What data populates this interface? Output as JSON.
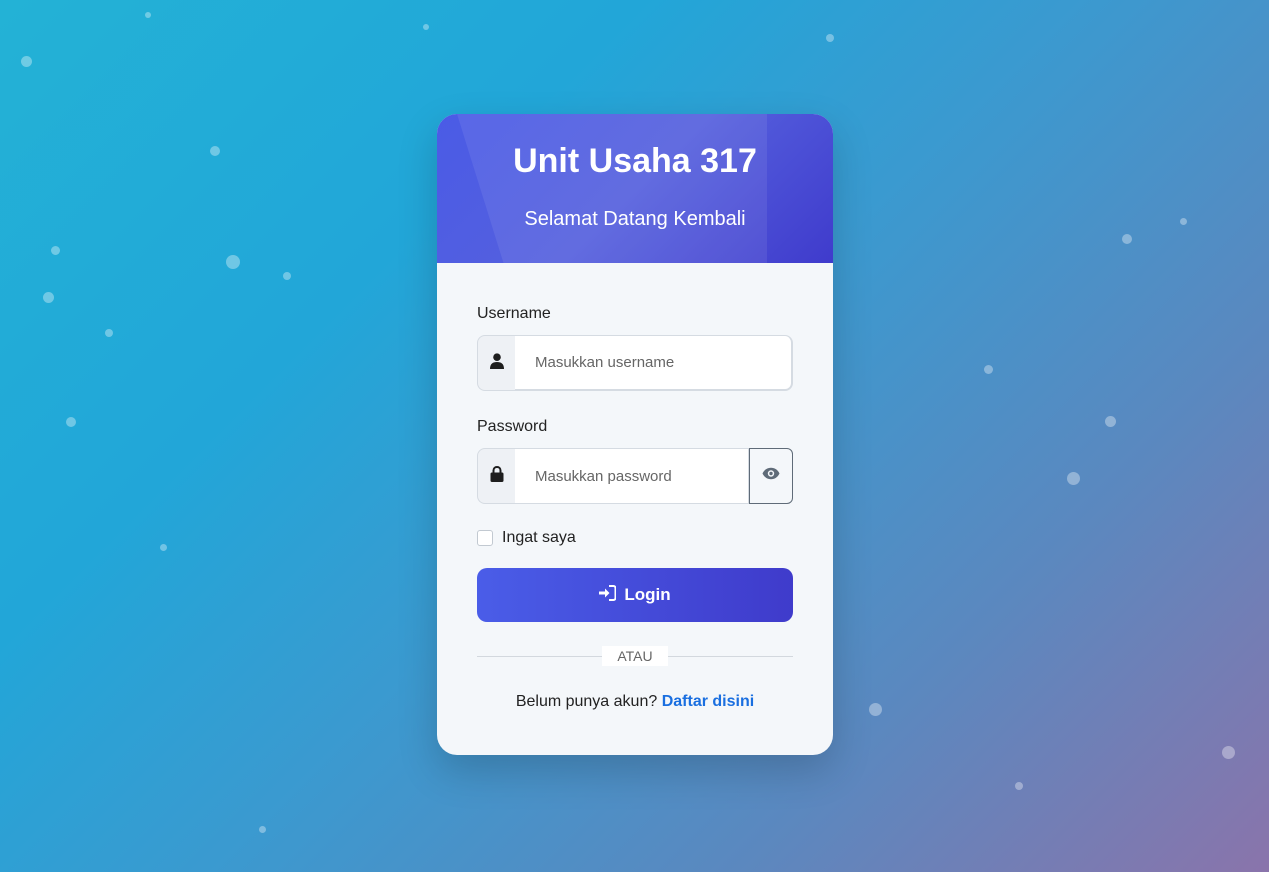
{
  "header": {
    "title": "Unit Usaha 317",
    "subtitle": "Selamat Datang Kembali"
  },
  "form": {
    "username_label": "Username",
    "username_placeholder": "Masukkan username",
    "username_value": "",
    "password_label": "Password",
    "password_placeholder": "Masukkan password",
    "password_value": "",
    "remember_label": "Ingat saya",
    "remember_checked": false,
    "login_label": "Login"
  },
  "divider": {
    "text": "ATAU"
  },
  "register": {
    "prompt": "Belum punya akun?",
    "link_label": "Daftar disini"
  },
  "icons": {
    "username": "user-icon",
    "password": "lock-icon",
    "toggle": "eye-icon",
    "login": "sign-in-icon"
  },
  "colors": {
    "header_gradient_start": "#4a5be6",
    "header_gradient_end": "#3f3bcc",
    "button_gradient_start": "#4a5de8",
    "button_gradient_end": "#3f3bcb",
    "link": "#1a6fe0",
    "card_background": "#f4f7fa"
  }
}
